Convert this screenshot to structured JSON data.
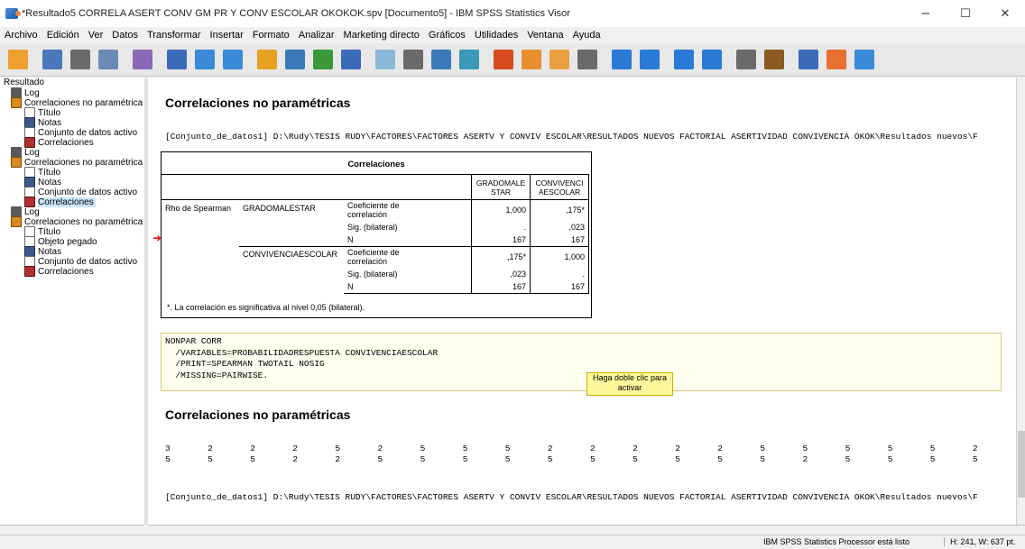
{
  "window": {
    "title": "*Resultado5 CORRELA ASERT CONV GM PR Y CONV ESCOLAR OKOKOK.spv [Documento5] - IBM SPSS Statistics Visor",
    "min": "−",
    "max": "☐",
    "close": "✕"
  },
  "menu": [
    "Archivo",
    "Edición",
    "Ver",
    "Datos",
    "Transformar",
    "Insertar",
    "Formato",
    "Analizar",
    "Marketing directo",
    "Gráficos",
    "Utilidades",
    "Ventana",
    "Ayuda"
  ],
  "toolbar_icons": [
    "open-folder-icon",
    "save-icon",
    "print-icon",
    "print-preview-icon",
    "export-icon",
    "recall-dialog-icon",
    "undo-icon",
    "redo-icon",
    "goto-case-icon",
    "goto-variable-icon",
    "variables-icon",
    "insert-chart-icon",
    "show-all-icon",
    "hide-icon",
    "select-all-icon",
    "select-last-icon",
    "insert-heading-icon",
    "insert-title-icon",
    "insert-text-icon",
    "designate-window-icon",
    "back-icon",
    "forward-icon",
    "expand-icon",
    "collapse-icon",
    "show-icon",
    "hide-outline-icon",
    "insert-new-icon",
    "insert-page-icon",
    "insert-text-file-icon"
  ],
  "tree": {
    "root": "Resultado",
    "items": [
      {
        "label": "Log",
        "icon": "log-icon",
        "level": 1
      },
      {
        "label": "Correlaciones no paramétrica",
        "icon": "group-icon",
        "level": 1
      },
      {
        "label": "Título",
        "icon": "title-icon",
        "level": 2
      },
      {
        "label": "Notas",
        "icon": "notes-icon",
        "level": 2
      },
      {
        "label": "Conjunto de datos activo",
        "icon": "dataset-icon",
        "level": 2
      },
      {
        "label": "Correlaciones",
        "icon": "table-icon",
        "level": 2
      },
      {
        "label": "Log",
        "icon": "log-icon",
        "level": 1
      },
      {
        "label": "Correlaciones no paramétrica",
        "icon": "group-icon",
        "level": 1
      },
      {
        "label": "Título",
        "icon": "title-icon",
        "level": 2
      },
      {
        "label": "Notas",
        "icon": "notes-icon",
        "level": 2
      },
      {
        "label": "Conjunto de datos activo",
        "icon": "dataset-icon",
        "level": 2
      },
      {
        "label": "Correlaciones",
        "icon": "table-icon",
        "level": 2,
        "selected": true
      },
      {
        "label": "Log",
        "icon": "log-icon",
        "level": 1
      },
      {
        "label": "Correlaciones no paramétrica",
        "icon": "group-icon",
        "level": 1
      },
      {
        "label": "Título",
        "icon": "title-icon",
        "level": 2
      },
      {
        "label": "Objeto pegado",
        "icon": "pasted-object-icon",
        "level": 2
      },
      {
        "label": "Notas",
        "icon": "notes-icon",
        "level": 2
      },
      {
        "label": "Conjunto de datos activo",
        "icon": "dataset-icon",
        "level": 2
      },
      {
        "label": "Correlaciones",
        "icon": "table-icon",
        "level": 2
      }
    ]
  },
  "content": {
    "heading1": "Correlaciones no paramétricas",
    "dataset1": "[Conjunto_de_datos1] D:\\Rudy\\TESIS RUDY\\FACTORES\\FACTORES ASERTV Y CONVIV ESCOLAR\\RESULTADOS NUEVOS FACTORIAL ASERTIVIDAD CONVIVENCIA OKOK\\Resultados nuevos\\F",
    "pivot": {
      "title": "Correlaciones",
      "col1": "GRADOMALE\nSTAR",
      "col2": "CONVIVENCI\nAESCOLAR",
      "rho": "Rho de Spearman",
      "var1": "GRADOMALESTAR",
      "var2": "CONVIVENCIAESCOLAR",
      "coef": "Coeficiente de\ncorrelación",
      "sig": "Sig. (bilateral)",
      "n": "N",
      "r1c1": "1,000",
      "r1c2": ",175*",
      "r2c1": ".",
      "r2c2": ",023",
      "r3c1": "167",
      "r3c2": "167",
      "r4c1": ",175*",
      "r4c2": "1,000",
      "r5c1": ",023",
      "r5c2": ".",
      "r6c1": "167",
      "r6c2": "167",
      "footnote": "*. La correlación es significativa al nivel 0,05 (bilateral)."
    },
    "syntax": [
      "NONPAR CORR",
      "  /VARIABLES=PROBABILIDADRESPUESTA CONVIVENCIAESCOLAR",
      "  /PRINT=SPEARMAN TWOTAIL NOSIG",
      "  /MISSING=PAIRWISE."
    ],
    "tooltip": "Haga doble clic para activar",
    "heading2": "Correlaciones no paramétricas",
    "row1": [
      "3",
      "2",
      "2",
      "2",
      "5",
      "2",
      "5",
      "5",
      "5",
      "2",
      "2",
      "2",
      "2",
      "2",
      "5",
      "5",
      "5",
      "5",
      "5",
      "2"
    ],
    "row2": [
      "5",
      "5",
      "5",
      "2",
      "2",
      "5",
      "5",
      "5",
      "5",
      "5",
      "5",
      "5",
      "5",
      "5",
      "5",
      "2",
      "5",
      "5",
      "5",
      "5"
    ],
    "dataset2": "[Conjunto_de_datos1] D:\\Rudy\\TESIS RUDY\\FACTORES\\FACTORES ASERTV Y CONVIV ESCOLAR\\RESULTADOS NUEVOS FACTORIAL ASERTIVIDAD CONVIVENCIA OKOK\\Resultados nuevos\\F"
  },
  "status": {
    "message": "IBM SPSS Statistics Processor está listo",
    "size": "H: 241, W: 637 pt."
  }
}
